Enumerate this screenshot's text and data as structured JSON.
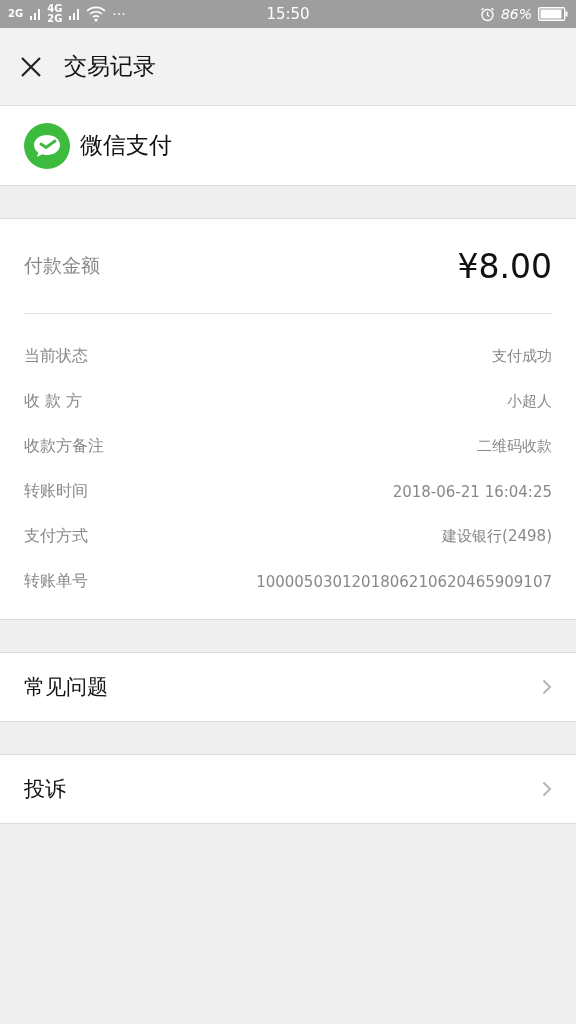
{
  "status_bar": {
    "network_labels": [
      "2G",
      "4G",
      "2G"
    ],
    "more": "···",
    "time": "15:50",
    "battery": "86%"
  },
  "header": {
    "title": "交易记录"
  },
  "merchant": {
    "name": "微信支付"
  },
  "amount": {
    "label": "付款金额",
    "value": "¥8.00"
  },
  "details": [
    {
      "label": "当前状态",
      "value": "支付成功"
    },
    {
      "label": "收 款 方",
      "value": "小超人"
    },
    {
      "label": "收款方备注",
      "value": "二维码收款"
    },
    {
      "label": "转账时间",
      "value": "2018-06-21 16:04:25"
    },
    {
      "label": "支付方式",
      "value": "建设银行(2498)"
    },
    {
      "label": "转账单号",
      "value": "1000050301201806210620465909107"
    }
  ],
  "links": [
    {
      "label": "常见问题"
    },
    {
      "label": "投诉"
    }
  ]
}
